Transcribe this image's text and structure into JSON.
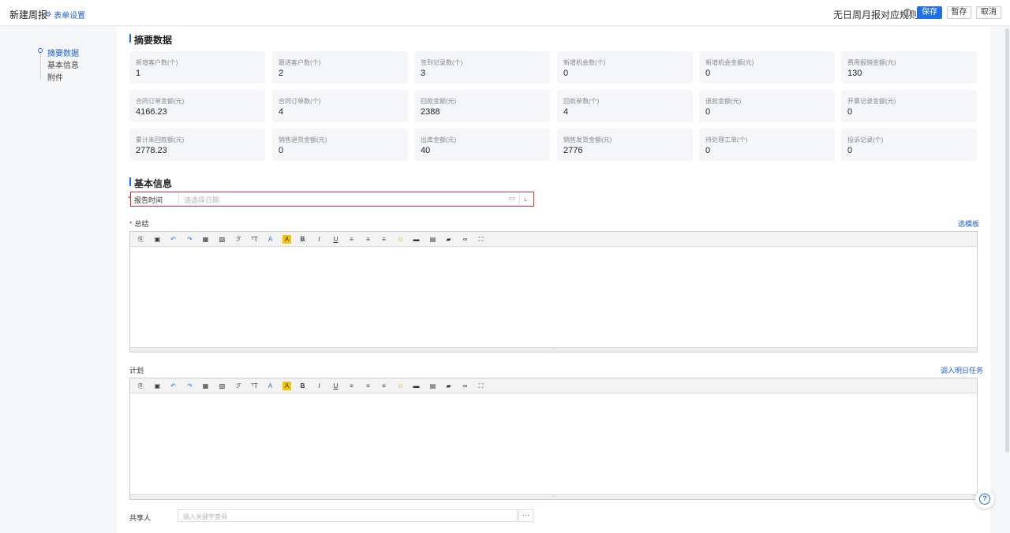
{
  "header": {
    "title": "新建周报",
    "form_settings": "表单设置",
    "rule_message": "无日周月报对应规则!",
    "save_label": "保存",
    "draft_label": "暂存",
    "cancel_label": "取消"
  },
  "sidebar": {
    "items": [
      {
        "label": "摘要数据",
        "active": true
      },
      {
        "label": "基本信息",
        "active": false
      },
      {
        "label": "附件",
        "active": false
      }
    ]
  },
  "summary": {
    "title": "摘要数据",
    "stats": [
      {
        "label": "新增客户数(个)",
        "value": "1"
      },
      {
        "label": "跟进客户数(个)",
        "value": "2"
      },
      {
        "label": "签到记录数(个)",
        "value": "3"
      },
      {
        "label": "新增机会数(个)",
        "value": "0"
      },
      {
        "label": "新增机会金额(元)",
        "value": "0"
      },
      {
        "label": "费用报销金额(元)",
        "value": "130"
      },
      {
        "label": "合同订单金额(元)",
        "value": "4166.23"
      },
      {
        "label": "合同订单数(个)",
        "value": "4"
      },
      {
        "label": "回款金额(元)",
        "value": "2388"
      },
      {
        "label": "回款单数(个)",
        "value": "4"
      },
      {
        "label": "退款金额(元)",
        "value": "0"
      },
      {
        "label": "开票记录金额(元)",
        "value": "0"
      },
      {
        "label": "累计未回款额(元)",
        "value": "2778.23"
      },
      {
        "label": "销售退货金额(元)",
        "value": "0"
      },
      {
        "label": "出库金额(元)",
        "value": "40"
      },
      {
        "label": "销售发货金额(元)",
        "value": "2776"
      },
      {
        "label": "待处理工单(个)",
        "value": "0"
      },
      {
        "label": "投诉记录(个)",
        "value": "0"
      }
    ]
  },
  "basic_info": {
    "title": "基本信息",
    "report_time_label": "报告时间",
    "report_time_placeholder": "请选择日期",
    "summary_label": "总结",
    "select_template": "选模板",
    "plan_label": "计划",
    "import_tomorrow": "调入明日任务",
    "sharer_label": "共享人",
    "sharer_placeholder": "输入关键字查询",
    "more_label": "···"
  },
  "colors": {
    "accent": "#1f6fe5",
    "highlight_border": "#e0282e"
  }
}
